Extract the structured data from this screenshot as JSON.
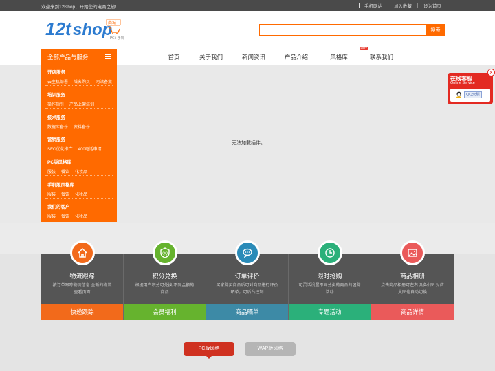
{
  "topbar": {
    "welcome": "欢迎来到12tshop，开始您的电商之旅!",
    "links": [
      "手机网站",
      "加入收藏",
      "设为首页"
    ]
  },
  "logo": {
    "text": "12tshop",
    "badge": "商城",
    "tag": "PC+手机"
  },
  "search": {
    "placeholder": "",
    "button": "搜索"
  },
  "catbar": {
    "title": "全部产品与服务"
  },
  "nav": [
    {
      "label": "首页"
    },
    {
      "label": "关于我们"
    },
    {
      "label": "新闻资讯"
    },
    {
      "label": "产品介绍"
    },
    {
      "label": "风格库",
      "badge": "HOT"
    },
    {
      "label": "联系我们"
    }
  ],
  "sidebar": [
    {
      "title": "开店服务",
      "items": [
        "云主机部署",
        "域名购买",
        "网站备案"
      ]
    },
    {
      "title": "培训服务",
      "items": [
        "操作指引",
        "产品上架培训"
      ]
    },
    {
      "title": "技术服务",
      "items": [
        "数据库备份",
        "资料备份"
      ]
    },
    {
      "title": "营销服务",
      "items": [
        "SEO优化推广",
        "400电话申请"
      ]
    },
    {
      "title": "PC版风格库",
      "items": [
        "服装",
        "餐饮",
        "化妆品"
      ]
    },
    {
      "title": "手机版风格库",
      "items": [
        "服装",
        "餐饮",
        "化妆品"
      ]
    },
    {
      "title": "我们的客户",
      "items": [
        "服装",
        "餐饮",
        "化妆品"
      ]
    }
  ],
  "main": {
    "plugin_message": "无法加载插件。"
  },
  "features": [
    {
      "icon": "house-icon",
      "title": "物流跟踪",
      "desc": "按订单跟踪物流信息 全新的物流查看页面",
      "button": "快递跟踪",
      "color": "#f26a1b",
      "btncolor": "#f26a1b"
    },
    {
      "icon": "shield-icon",
      "title": "积分兑换",
      "desc": "根据用户积分可兑换 不同金额的商品",
      "button": "会员福利",
      "color": "#66b32e",
      "btncolor": "#66b32e"
    },
    {
      "icon": "chat-icon",
      "title": "订单评价",
      "desc": "买家购买商品后可对商品进行评价晒单，可后台控制",
      "button": "商品晒单",
      "color": "#2a8bb8",
      "btncolor": "#3d8aa6"
    },
    {
      "icon": "clock-icon",
      "title": "限时抢购",
      "desc": "可灵活设置不同分类的商品的团购活动",
      "button": "专题活动",
      "color": "#2bb07a",
      "btncolor": "#2bb07a"
    },
    {
      "icon": "picture-icon",
      "title": "商品相册",
      "desc": "点击商品相册可左右切换小图 对应大图也自动切换",
      "button": "商品详情",
      "color": "#ea5a5a",
      "btncolor": "#ea5a5a"
    }
  ],
  "tabs": {
    "pc": "PC版风格",
    "wap": "WAP版风格"
  },
  "service": {
    "title": "在线客服",
    "subtitle": "Online Service",
    "qq": "QQ交谈",
    "close": "×"
  }
}
